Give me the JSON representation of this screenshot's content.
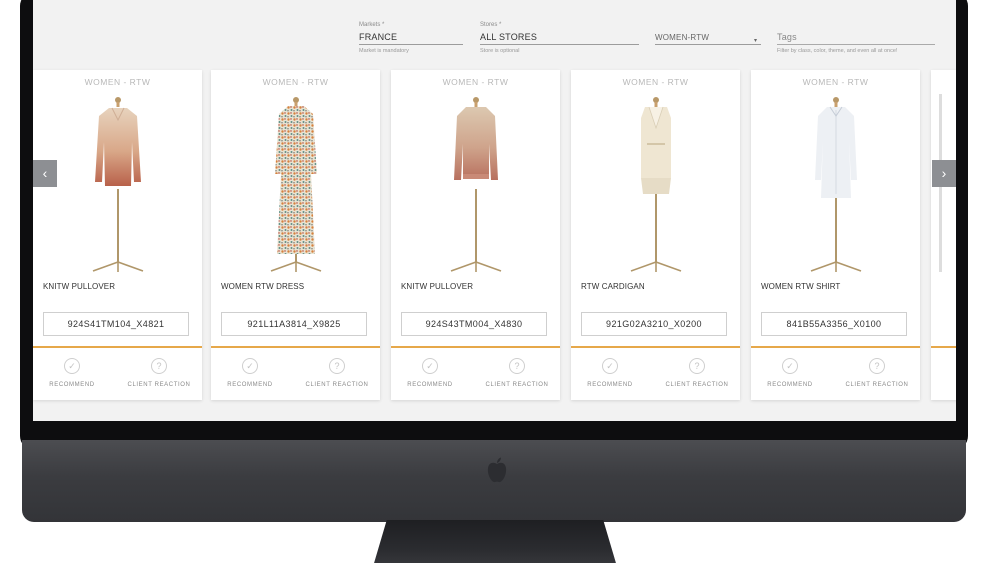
{
  "filters": {
    "market": {
      "label": "Markets *",
      "value": "FRANCE",
      "hint": "Market is mandatory"
    },
    "store": {
      "label": "Stores *",
      "value": "ALL STORES",
      "hint": "Store is optional"
    },
    "category": {
      "value": "WOMEN-RTW",
      "caret": "▾"
    },
    "tags": {
      "placeholder": "Tags",
      "hint": "Filter by class, color, theme, and even all at once!"
    }
  },
  "carousel": {
    "prev_icon": "chevron-left-icon",
    "next_icon": "chevron-right-icon",
    "prev_glyph": "‹",
    "next_glyph": "›",
    "cards": [
      {
        "category": "WOMEN - RTW",
        "name": "KNITW PULLOVER",
        "code": "924S41TM104_X4821",
        "garment": "ombre-pullover",
        "recommend_label": "RECOMMEND",
        "reaction_label": "CLIENT REACTION"
      },
      {
        "category": "WOMEN - RTW",
        "name": "WOMEN RTW DRESS",
        "code": "921L11A3814_X9825",
        "garment": "floral-dress",
        "recommend_label": "RECOMMEND",
        "reaction_label": "CLIENT REACTION"
      },
      {
        "category": "WOMEN - RTW",
        "name": "KNITW PULLOVER",
        "code": "924S43TM004_X4830",
        "garment": "ombre-sweater",
        "recommend_label": "RECOMMEND",
        "reaction_label": "CLIENT REACTION"
      },
      {
        "category": "WOMEN - RTW",
        "name": "RTW CARDIGAN",
        "code": "921G02A3210_X0200",
        "garment": "cream-vest",
        "recommend_label": "RECOMMEND",
        "reaction_label": "CLIENT REACTION"
      },
      {
        "category": "WOMEN - RTW",
        "name": "WOMEN RTW SHIRT",
        "code": "841B55A3356_X0100",
        "garment": "white-shirt",
        "recommend_label": "RECOMMEND",
        "reaction_label": "CLIENT REACTION"
      }
    ]
  },
  "colors": {
    "accent": "#e6a84a",
    "screen_bg": "#f2f2f2",
    "nav_button": "#8d8f93"
  }
}
